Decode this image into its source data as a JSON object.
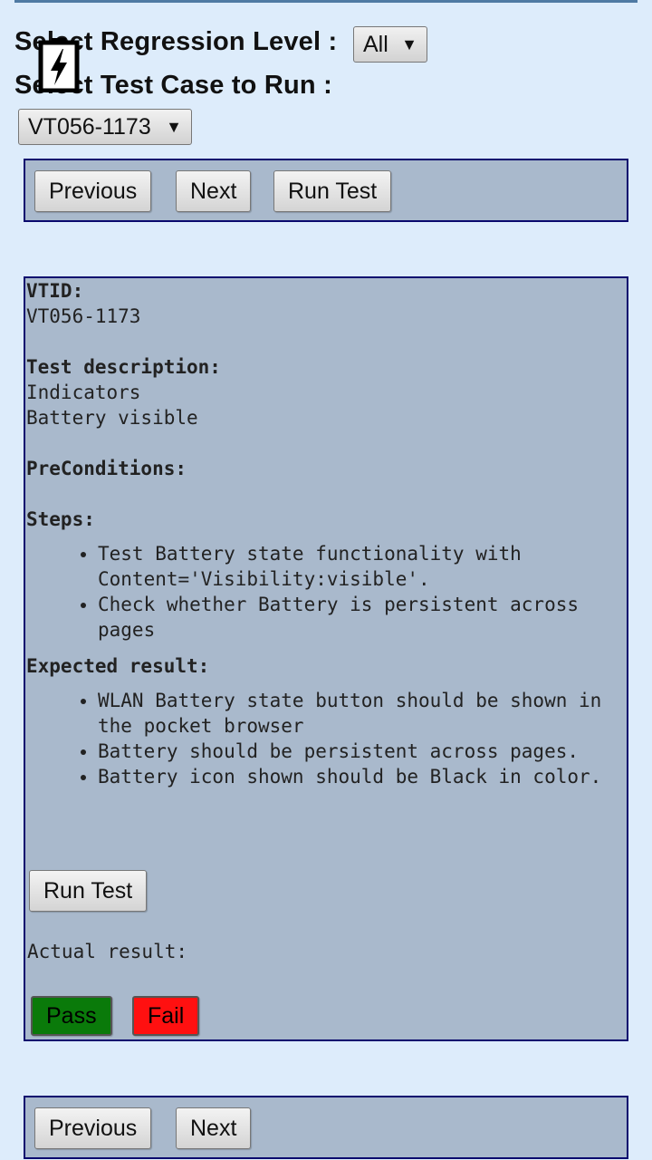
{
  "header": {
    "regression_label": "Select Regression Level :",
    "regression_value": "All",
    "testcase_label": "Select Test Case to Run :",
    "testcase_value": "VT056-1173"
  },
  "nav_top": {
    "previous": "Previous",
    "next": "Next",
    "run": "Run Test"
  },
  "details": {
    "vtid_label": "VTID:",
    "vtid_value": "VT056-1173",
    "desc_label": "Test description:",
    "desc_line1": "Indicators",
    "desc_line2": "Battery visible",
    "pre_label": "PreConditions:",
    "steps_label": "Steps:",
    "steps": [
      "Test Battery state functionality with Content='Visibility:visible'.",
      "Check whether Battery is persistent across pages"
    ],
    "expected_label": "Expected result:",
    "expected": [
      "WLAN Battery state button should be shown in the pocket browser",
      "Battery should be persistent across pages.",
      "Battery icon shown should be Black in color."
    ],
    "run_button": "Run Test",
    "actual_label": "Actual result:",
    "pass": "Pass",
    "fail": "Fail"
  },
  "nav_bottom": {
    "previous": "Previous",
    "next": "Next"
  },
  "icons": {
    "battery": "battery-charging-icon"
  },
  "colors": {
    "background": "#ddecfb",
    "panel": "#a9b9cc",
    "panel_border": "#0a0a6e",
    "pass": "#0a7a0a",
    "fail": "#ff1010"
  }
}
